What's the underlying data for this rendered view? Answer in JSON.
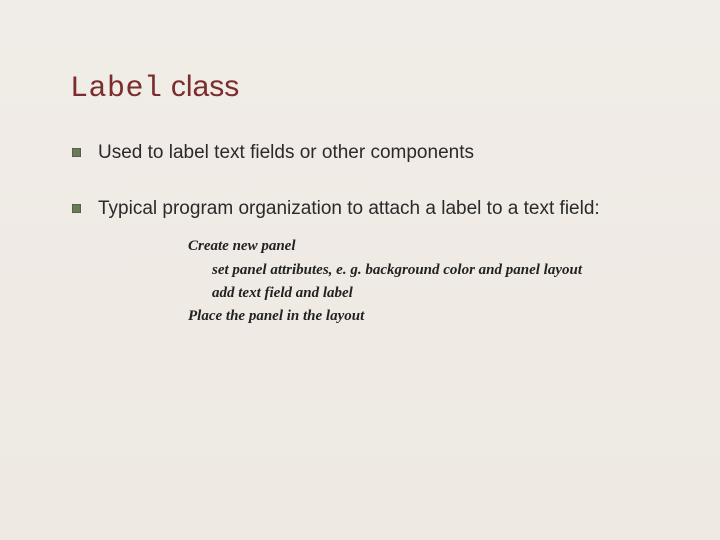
{
  "title": {
    "code_part": "Label",
    "plain_part": " class"
  },
  "bullets": [
    {
      "text": "Used to label text fields or other components",
      "sub": []
    },
    {
      "text": "Typical program organization to attach a label to a text field:",
      "sub": [
        {
          "text": "Create new panel",
          "indent": false
        },
        {
          "text": "set panel attributes, e. g. background color and panel layout",
          "indent": true
        },
        {
          "text": "add text field and label",
          "indent": true
        },
        {
          "text": "Place the panel in the layout",
          "indent": false
        }
      ]
    }
  ]
}
